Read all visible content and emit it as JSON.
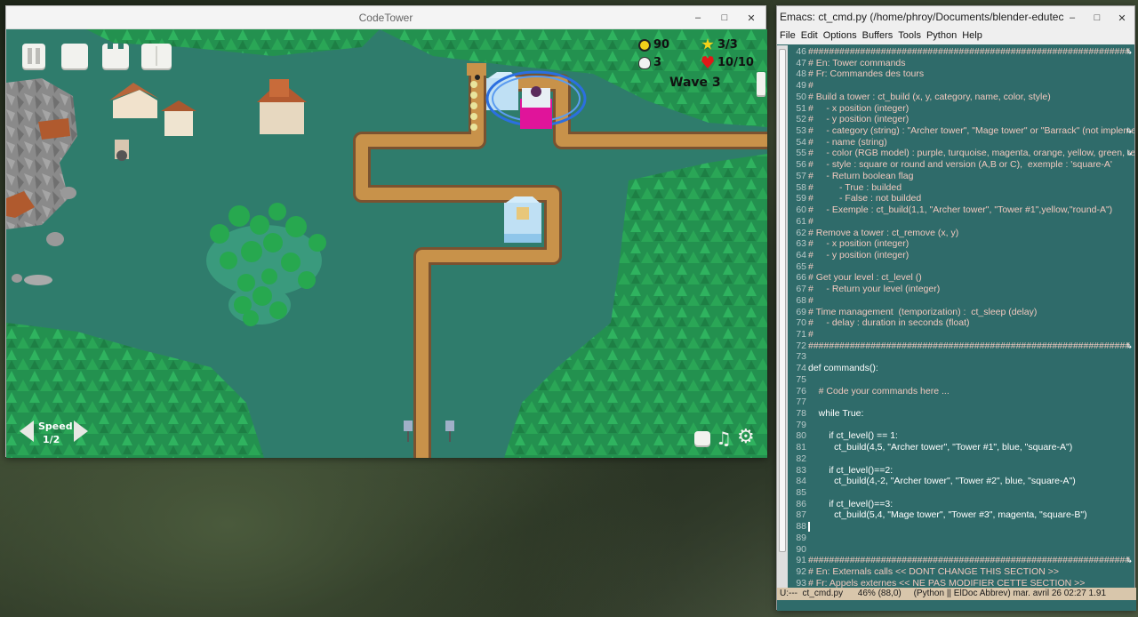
{
  "game_window": {
    "title": "CodeTower",
    "controls": [
      "–",
      "□",
      "✕"
    ]
  },
  "hud": {
    "coins": "90",
    "stars": "3/3",
    "kills": "3",
    "lives": "10/10",
    "wave": "Wave 3",
    "speed_label": "Speed",
    "speed_value": "1/2"
  },
  "emacs": {
    "title": "Emacs: ct_cmd.py (/home/phroy/Documents/blender-edutech/codetower...",
    "controls": [
      "–",
      "□",
      "✕"
    ],
    "menu": [
      "File",
      "Edit",
      "Options",
      "Buffers",
      "Tools",
      "Python",
      "Help"
    ],
    "lines": [
      {
        "n": "46",
        "t": "##############################################################",
        "c": "cm",
        "trunc": true
      },
      {
        "n": "47",
        "t": "# En: Tower commands",
        "c": "cm"
      },
      {
        "n": "48",
        "t": "# Fr: Commandes des tours",
        "c": "cm"
      },
      {
        "n": "49",
        "t": "#",
        "c": "cm"
      },
      {
        "n": "50",
        "t": "# Build a tower : ct_build (x, y, category, name, color, style)",
        "c": "cm"
      },
      {
        "n": "51",
        "t": "#     - x position (integer)",
        "c": "cm"
      },
      {
        "n": "52",
        "t": "#     - y position (integer)",
        "c": "cm"
      },
      {
        "n": "53",
        "t": "#     - category (string) : \"Archer tower\", \"Mage tower\" or \"Barrack\" (not impleme",
        "c": "cm",
        "trunc": true
      },
      {
        "n": "54",
        "t": "#     - name (string)",
        "c": "cm"
      },
      {
        "n": "55",
        "t": "#     - color (RGB model) : purple, turquoise, magenta, orange, yellow, green, red o",
        "c": "cm",
        "trunc": true
      },
      {
        "n": "56",
        "t": "#     - style : square or round and version (A,B or C),  exemple : 'square-A'",
        "c": "cm"
      },
      {
        "n": "57",
        "t": "#     - Return boolean flag",
        "c": "cm"
      },
      {
        "n": "58",
        "t": "#          - True : builded",
        "c": "cm"
      },
      {
        "n": "59",
        "t": "#          - False : not builded",
        "c": "cm"
      },
      {
        "n": "60",
        "t": "#     - Exemple : ct_build(1,1, \"Archer tower\", \"Tower #1\",yellow,\"round-A\")",
        "c": "cm"
      },
      {
        "n": "61",
        "t": "#",
        "c": "cm"
      },
      {
        "n": "62",
        "t": "# Remove a tower : ct_remove (x, y)",
        "c": "cm"
      },
      {
        "n": "63",
        "t": "#     - x position (integer)",
        "c": "cm"
      },
      {
        "n": "64",
        "t": "#     - y position (integer)",
        "c": "cm"
      },
      {
        "n": "65",
        "t": "#",
        "c": "cm"
      },
      {
        "n": "66",
        "t": "# Get your level : ct_level ()",
        "c": "cm"
      },
      {
        "n": "67",
        "t": "#     - Return your level (integer)",
        "c": "cm"
      },
      {
        "n": "68",
        "t": "#",
        "c": "cm"
      },
      {
        "n": "69",
        "t": "# Time management  (temporization) :  ct_sleep (delay)",
        "c": "cm"
      },
      {
        "n": "70",
        "t": "#     - delay : duration in seconds (float)",
        "c": "cm"
      },
      {
        "n": "71",
        "t": "#",
        "c": "cm"
      },
      {
        "n": "72",
        "t": "##############################################################",
        "c": "cm",
        "trunc": true
      },
      {
        "n": "73",
        "t": "",
        "c": ""
      },
      {
        "n": "74",
        "t": "def commands():",
        "c": "kw"
      },
      {
        "n": "75",
        "t": "",
        "c": ""
      },
      {
        "n": "76",
        "t": "    # Code your commands here ...",
        "c": "cm"
      },
      {
        "n": "77",
        "t": "",
        "c": ""
      },
      {
        "n": "78",
        "t": "    while True:",
        "c": "kw"
      },
      {
        "n": "79",
        "t": "",
        "c": ""
      },
      {
        "n": "80",
        "t": "        if ct_level() == 1:",
        "c": "kw"
      },
      {
        "n": "81",
        "t": "          ct_build(4,5, \"Archer tower\", \"Tower #1\", blue, \"square-A\")",
        "c": "kw"
      },
      {
        "n": "82",
        "t": "",
        "c": ""
      },
      {
        "n": "83",
        "t": "        if ct_level()==2:",
        "c": "kw"
      },
      {
        "n": "84",
        "t": "          ct_build(4,-2, \"Archer tower\", \"Tower #2\", blue, \"square-A\")",
        "c": "kw"
      },
      {
        "n": "85",
        "t": "",
        "c": ""
      },
      {
        "n": "86",
        "t": "        if ct_level()==3:",
        "c": "kw"
      },
      {
        "n": "87",
        "t": "          ct_build(5,4, \"Mage tower\", \"Tower #3\", magenta, \"square-B\")",
        "c": "kw"
      },
      {
        "n": "88",
        "t": "",
        "c": "",
        "cursor": true
      },
      {
        "n": "89",
        "t": "",
        "c": ""
      },
      {
        "n": "90",
        "t": "",
        "c": ""
      },
      {
        "n": "91",
        "t": "##############################################################",
        "c": "cm",
        "trunc": true
      },
      {
        "n": "92",
        "t": "# En: Externals calls << DONT CHANGE THIS SECTION >>",
        "c": "cm"
      },
      {
        "n": "93",
        "t": "# Fr: Appels externes << NE PAS MODIFIER CETTE SECTION >>",
        "c": "cm"
      }
    ],
    "modeline": "U:---  ct_cmd.py      46% (88,0)     (Python || ElDoc Abbrev) mar. avril 26 02:27 1.91"
  }
}
